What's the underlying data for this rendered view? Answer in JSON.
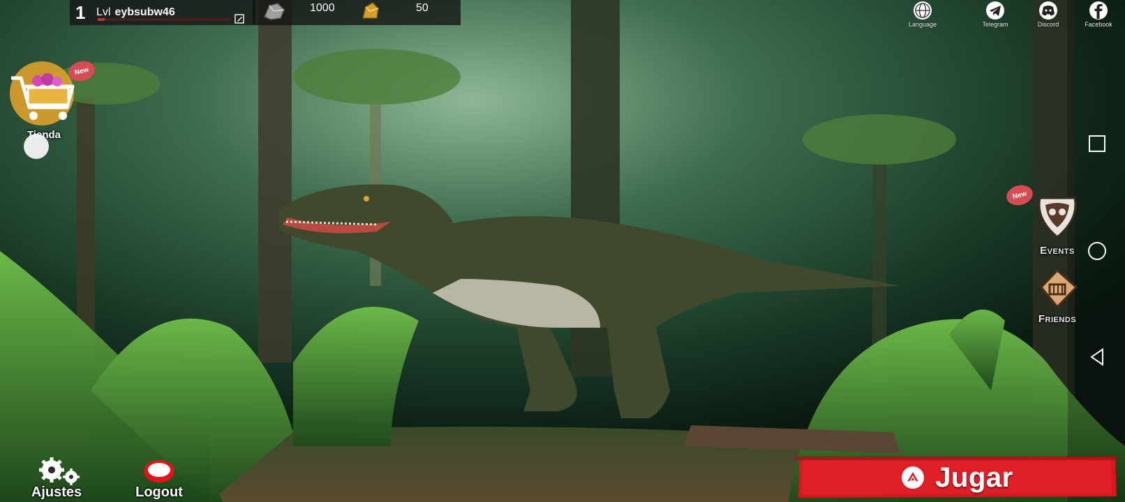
{
  "player": {
    "level": "1",
    "level_prefix": "Lvl",
    "username": "eybsubw46",
    "xp_progress": 0.05
  },
  "resources": [
    {
      "name": "stone",
      "icon": "stone-icon",
      "value": "1000"
    },
    {
      "name": "gold",
      "icon": "gold-icon",
      "value": "50"
    }
  ],
  "social": [
    {
      "label": "Language",
      "icon": "globe-icon"
    },
    {
      "label": "Telegram",
      "icon": "telegram-icon"
    },
    {
      "label": "Discord",
      "icon": "discord-icon"
    },
    {
      "label": "Facebook",
      "icon": "facebook-icon"
    }
  ],
  "shop": {
    "label": "Tienda",
    "badge": "New"
  },
  "events": {
    "label": "Events",
    "badge": "New"
  },
  "friends": {
    "label": "Friends"
  },
  "settings": {
    "label": "Ajustes"
  },
  "logout": {
    "label": "Logout"
  },
  "play": {
    "label": "Jugar"
  },
  "colors": {
    "play_red": "#d8161c",
    "topbar_bg": "#141414",
    "badge_red": "#d64b54"
  }
}
